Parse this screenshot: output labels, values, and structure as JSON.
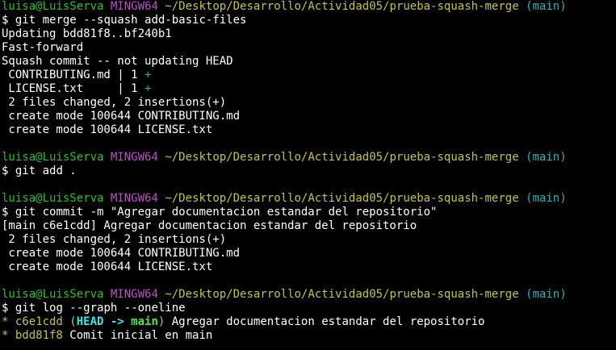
{
  "prompt": {
    "user": "luisa@LuisServa",
    "system": "MINGW64",
    "path": "~/Desktop/Desarrollo/Actividad05/prueba-squash-merge",
    "branch": "(main)",
    "symbol": "$"
  },
  "colors": {
    "background": "#000000",
    "user": "#22c322",
    "system": "#c14ec9",
    "path": "#c5c535",
    "branch": "#2ab3b3",
    "diff_add": "#22c322",
    "head_ref": "#38e8e8",
    "branch_ref": "#3ff03f"
  },
  "blocks": [
    {
      "command": "git merge --squash add-basic-files",
      "output": [
        "Updating bdd81f8..bf240b1",
        "Fast-forward",
        "Squash commit -- not updating HEAD"
      ],
      "diffstat": [
        {
          "file": " CONTRIBUTING.md | 1 ",
          "plus": "+"
        },
        {
          "file": " LICENSE.txt     | 1 ",
          "plus": "+"
        }
      ],
      "summary": [
        " 2 files changed, 2 insertions(+)",
        " create mode 100644 CONTRIBUTING.md",
        " create mode 100644 LICENSE.txt"
      ]
    },
    {
      "command": "git add ."
    },
    {
      "command": "git commit -m \"Agregar documentacion estandar del repositorio\"",
      "output": [
        "[main c6e1cdd] Agregar documentacion estandar del repositorio",
        " 2 files changed, 2 insertions(+)",
        " create mode 100644 CONTRIBUTING.md",
        " create mode 100644 LICENSE.txt"
      ]
    },
    {
      "command": "git log --graph --oneline",
      "log": [
        {
          "graph": "* ",
          "hash": "c6e1cdd",
          "refs_open": " (",
          "head": "HEAD",
          "arrow": " -> ",
          "branch": "main",
          "refs_close": ")",
          "message": " Agregar documentacion estandar del repositorio"
        },
        {
          "graph": "* ",
          "hash": "bdd81f8",
          "message": " Comit inicial en main"
        }
      ]
    }
  ]
}
